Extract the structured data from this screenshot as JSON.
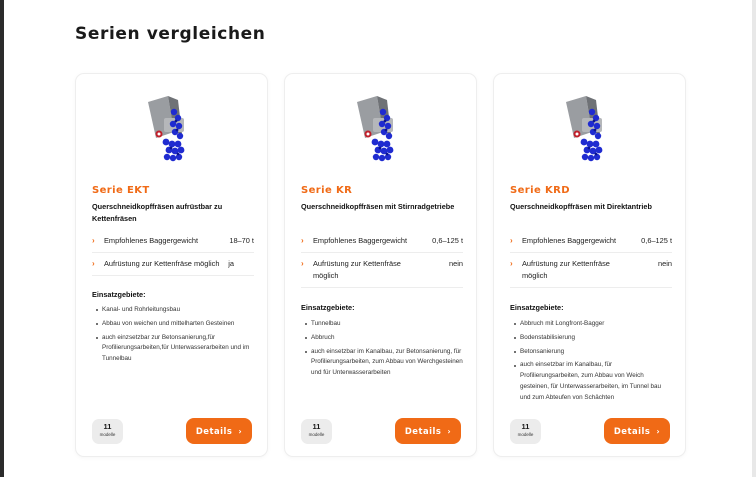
{
  "page": {
    "title": "Serien vergleichen"
  },
  "colors": {
    "accent": "#f06a16",
    "badge_bg": "#ececec",
    "card_border": "#eeeeee"
  },
  "cards": [
    {
      "series": "Serie EKT",
      "description": "Querschneidkopffräsen aufrüstbar zu Kettenfräsen",
      "specs": [
        {
          "label": "Empfohlenes Baggergewicht",
          "value": "18–70 t"
        },
        {
          "label": "Aufrüstung zur Kettenfräse möglich",
          "value": "ja"
        }
      ],
      "uses_heading": "Einsatzgebiete:",
      "uses": [
        "Kanal- und Rohrleitungsbau",
        "Abbau von weichen und mittelharten Gesteinen",
        "auch einzsetzbar zur Betonsanierung,für Profilierungsarbeiten,für Unterwasserarbeiten und im Tunnelbau"
      ],
      "model_count": "11",
      "model_label": "modelle",
      "button_label": "Details",
      "button_icon": "chevron-right-icon"
    },
    {
      "series": "Serie KR",
      "description": "Querschneidkopffräsen mit Stirnradgetriebe",
      "specs": [
        {
          "label": "Empfohlenes Baggergewicht",
          "value": "0,6–125 t"
        },
        {
          "label": "Aufrüstung zur Kettenfräse möglich",
          "value": "nein"
        }
      ],
      "uses_heading": "Einsatzgebiete:",
      "uses": [
        "Tunnelbau",
        "Abbruch",
        "auch einsetzbar im Kanalbau, zur Betonsanierung, für Profilierungsarbeiten, zum Abbau von Werchgesteinen und für Unterwasserarbeiten"
      ],
      "model_count": "11",
      "model_label": "modelle",
      "button_label": "Details",
      "button_icon": "chevron-right-icon"
    },
    {
      "series": "Serie KRD",
      "description": "Querschneidkopffräsen mit Direktantrieb",
      "specs": [
        {
          "label": "Empfohlenes Baggergewicht",
          "value": "0,6–125 t"
        },
        {
          "label": "Aufrüstung zur Kettenfräse möglich",
          "value": "nein"
        }
      ],
      "uses_heading": "Einsatzgebiete:",
      "uses": [
        "Abbruch mit Longfront-Bagger",
        "Bodenstabilisierung",
        "Betonsanierung",
        "auch einsetzbar im Kanalbau, für Profilierungsarbeiten, zum Abbau von Weich gesteinen, für Unterwasserarbeiten, im Tunnel bau und zum Abteufen von Schächten"
      ],
      "model_count": "11",
      "model_label": "modelle",
      "button_label": "Details",
      "button_icon": "chevron-right-icon"
    }
  ]
}
